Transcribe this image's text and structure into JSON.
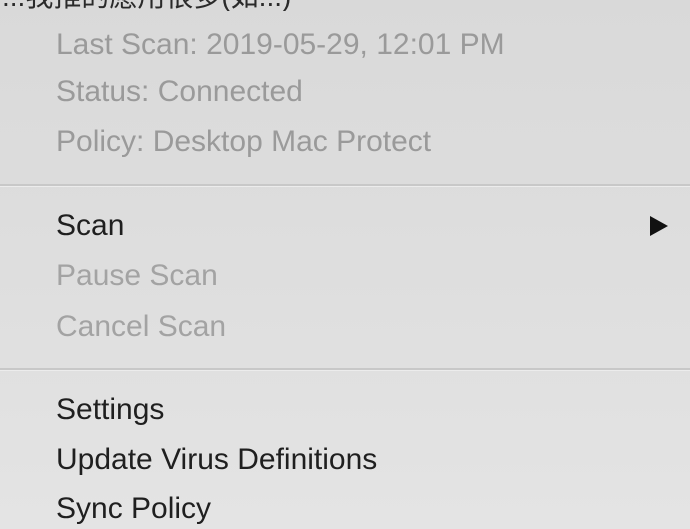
{
  "menu": {
    "top_partial_text": "...我推的應用很多(如...)",
    "info": {
      "last_scan": "Last Scan: 2019-05-29, 12:01 PM",
      "status": "Status: Connected",
      "policy": "Policy: Desktop Mac Protect"
    },
    "items": {
      "scan": "Scan",
      "pause_scan": "Pause Scan",
      "cancel_scan": "Cancel Scan",
      "settings": "Settings",
      "update_virus_definitions": "Update Virus Definitions",
      "sync_policy": "Sync Policy"
    },
    "icons": {
      "submenu_arrow": "chevron-right-icon"
    },
    "colors": {
      "background": "#dedede",
      "enabled_text": "#1f1f1f",
      "disabled_text": "#a3a3a3",
      "info_text": "#9a9a9a",
      "separator": "#c8c8c8"
    }
  }
}
